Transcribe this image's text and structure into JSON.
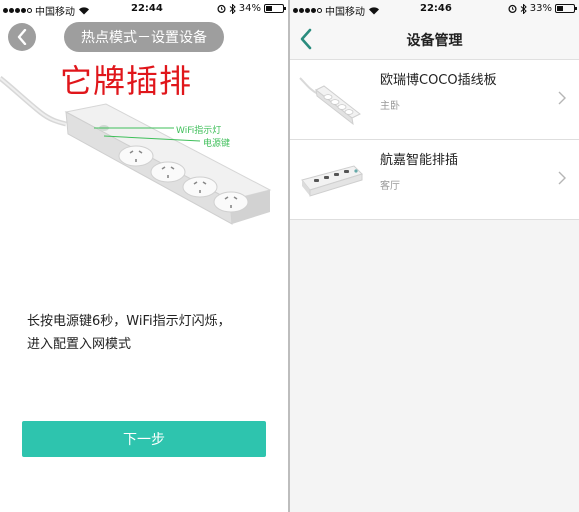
{
  "left_screen": {
    "status_bar": {
      "carrier": "中国移动",
      "time": "22:44",
      "battery": "34%",
      "battery_level": 0.34,
      "icons": [
        "signal-icon",
        "wifi-icon",
        "alarm-icon",
        "bluetooth-icon",
        "battery-icon"
      ]
    },
    "header": {
      "title": "热点模式－设置设备",
      "back_icon": "chevron-left-icon"
    },
    "product_heading": "它牌插排",
    "product_labels": {
      "wifi_indicator": "WiFi指示灯",
      "power_key": "电源键"
    },
    "instruction_line1": "长按电源键6秒，WiFi指示灯闪烁，",
    "instruction_line2": "进入配置入网模式",
    "next_button": "下一步",
    "colors": {
      "accent": "#2ec4ae",
      "heading_red": "#e0161b",
      "label_green": "#3fbf5a",
      "pill_gray": "#9e9e9e"
    }
  },
  "right_screen": {
    "status_bar": {
      "carrier": "中国移动",
      "time": "22:46",
      "battery": "33%",
      "battery_level": 0.33,
      "icons": [
        "signal-icon",
        "wifi-icon",
        "alarm-icon",
        "bluetooth-icon",
        "battery-icon"
      ]
    },
    "nav": {
      "title": "设备管理",
      "back_icon": "chevron-left-icon",
      "back_color": "#2a8c7e"
    },
    "devices": [
      {
        "name": "欧瑞博COCO插线板",
        "room": "主卧",
        "icon": "power-strip-icon"
      },
      {
        "name": "航嘉智能排插",
        "room": "客厅",
        "icon": "power-strip-icon"
      }
    ]
  }
}
